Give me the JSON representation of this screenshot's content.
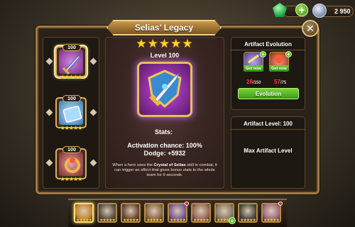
{
  "window": {
    "title": "Selias' Legacy"
  },
  "currency": {
    "gems": "47",
    "gold": "2 950"
  },
  "artifacts": [
    {
      "level": "100",
      "stars": "★★★★★",
      "icon": "sword-icon",
      "selected": true
    },
    {
      "level": "100",
      "stars": "★★★★★",
      "icon": "scroll-book-icon",
      "selected": false
    },
    {
      "level": "100",
      "stars": "★★★★★",
      "icon": "dragon-ring-icon",
      "selected": false
    }
  ],
  "detail": {
    "stars": "★★★★★",
    "level_label": "Level 100",
    "stats_label": "Stats:",
    "stats": [
      {
        "text": "Activation chance: 100%"
      },
      {
        "text": "Dodge: +5932"
      }
    ],
    "desc_before": "When a hero uses the ",
    "desc_skill": "Crystal of Selias",
    "desc_after": " skill in combat, it can trigger an effect that gives bonus stats to the whole team for 9 seconds."
  },
  "evolution": {
    "title": "Artifact Evolution",
    "materials": [
      {
        "have": "28",
        "need": "/150",
        "get_now": "Get now",
        "accent": "#6a5aa8"
      },
      {
        "have": "57",
        "need": "/75",
        "get_now": "Get now",
        "accent": "#a83a3a"
      }
    ],
    "button_label": "Evolution"
  },
  "artifact_level": {
    "title": "Artifact Level: 100",
    "max_text": "Max Artifact Level"
  },
  "heroes": [
    {
      "stars": "★★★★★",
      "color": "#c8843a",
      "selected": true
    },
    {
      "stars": "★★★★★",
      "color": "#5a5048"
    },
    {
      "stars": "★★★★★",
      "color": "#6a4a3a"
    },
    {
      "stars": "★★★★★",
      "color": "#8a6a4a"
    },
    {
      "stars": "★★★★★",
      "color": "#7a5aa0",
      "dot": true
    },
    {
      "stars": "★★★★★",
      "color": "#9a6a5a"
    },
    {
      "stars": "★★★★★",
      "color": "#8a7a6a",
      "plus": true
    },
    {
      "stars": "★★★★★",
      "color": "#4a4a40"
    },
    {
      "stars": "★★★★★",
      "color": "#a06a8a",
      "dot": true
    }
  ]
}
